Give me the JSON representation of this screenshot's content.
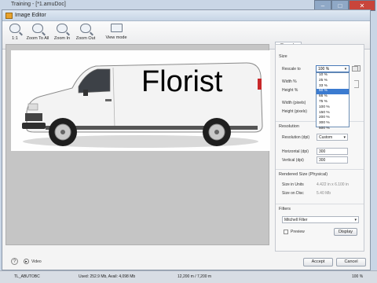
{
  "outer_window": {
    "title": "Training - [*1.amuDoc]",
    "min_icon": "minimize-icon",
    "max_icon": "maximize-icon",
    "close_icon": "close-icon"
  },
  "dialog": {
    "title": "Image Editor",
    "toolbar": [
      {
        "label": "1:1",
        "icon": "actual-size-icon"
      },
      {
        "label": "Zoom To All",
        "icon": "zoom-all-icon"
      },
      {
        "label": "Zoom In",
        "icon": "zoom-in-icon"
      },
      {
        "label": "Zoom Out",
        "icon": "zoom-out-icon"
      },
      {
        "label": "View mode",
        "icon": "view-mode-icon"
      }
    ],
    "image": {
      "van_text": "Florist"
    },
    "panel": {
      "tab": "Rescale",
      "size_section": "Size",
      "rescale_label": "Rescale to",
      "rescale_value": "100 %",
      "width_label": "Width %",
      "height_label": "Height %",
      "width_px_label": "Width (pixels)",
      "height_px_label": "Height (pixels)",
      "dropdown_options": [
        "10 %",
        "25 %",
        "33 %",
        "50 %",
        "66 %",
        "75 %",
        "100 %",
        "150 %",
        "200 %",
        "300 %",
        "500 %"
      ],
      "dropdown_selected_index": 3,
      "resolution_section": "Resolution",
      "resolution_label": "Resolution (dpi)",
      "resolution_value": "Custom",
      "horizontal_label": "Horizontal (dpi)",
      "horizontal_value": "300",
      "vertical_label": "Vertical (dpi)",
      "vertical_value": "300",
      "rendered_section": "Rendered Size (Physical)",
      "size_units_label": "Size in Units",
      "size_units_value": "4.422 in x 6.100 in",
      "size_disc_label": "Size on Disc",
      "size_disc_value": "5.40 Mb",
      "filters_section": "Filters",
      "filter_value": "Mitchell Filter",
      "preview_label": "Preview",
      "display_button": "Display"
    },
    "footer": {
      "video_label": "Video",
      "accept_button": "Accept",
      "cancel_button": "Cancel"
    }
  },
  "statusbar": {
    "left": "TL_ABUTOBC",
    "middle": "Used: 252.9 Mb, Avail: 4,098 Mb",
    "coords": "12,200 m / 7,200 m",
    "zoom": "100 %"
  }
}
